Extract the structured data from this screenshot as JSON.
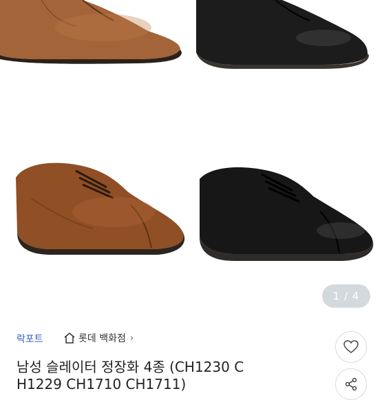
{
  "gallery": {
    "counter_current": "1",
    "counter_separator": " / ",
    "counter_total": "4",
    "shoes": [
      {
        "name": "tan-derby-top-left",
        "color": "#a0633a"
      },
      {
        "name": "black-derby-top-right",
        "color": "#1b1b1b"
      },
      {
        "name": "tan-captoe-bottom-left",
        "color": "#8e4f25"
      },
      {
        "name": "black-captoe-bottom-right",
        "color": "#161616"
      }
    ]
  },
  "product": {
    "brand": "락포트",
    "store": "롯데 백화점",
    "store_icon": "house-icon",
    "title_line1": "남성 슬레이터 정장화 4종 (CH1230 C",
    "title_line2": "H1229 CH1710 CH1711)",
    "favorite_icon": "heart-icon",
    "share_icon": "share-icon"
  },
  "colors": {
    "brand_link": "#2f5fc4",
    "counter_bg": "#d4d9de"
  }
}
